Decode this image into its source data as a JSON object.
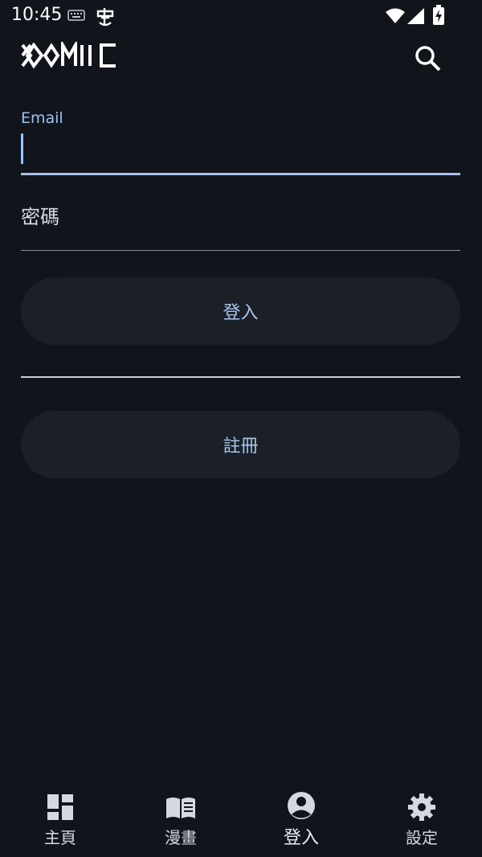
{
  "status_bar": {
    "time": "10:45"
  },
  "app": {
    "logo_text": "KOMIIC"
  },
  "form": {
    "email_label": "Email",
    "email_value": "",
    "password_label": "密碼",
    "login_label": "登入",
    "register_label": "註冊"
  },
  "bottom_nav": {
    "items": [
      {
        "label": "主頁",
        "icon": "dashboard-icon"
      },
      {
        "label": "漫畫",
        "icon": "book-icon"
      },
      {
        "label": "登入",
        "icon": "account-circle-icon"
      },
      {
        "label": "設定",
        "icon": "gear-icon"
      }
    ],
    "active": "登入"
  },
  "colors": {
    "background": "#11141a",
    "accent": "#9cc2f0",
    "pill": "#1b1f26"
  }
}
